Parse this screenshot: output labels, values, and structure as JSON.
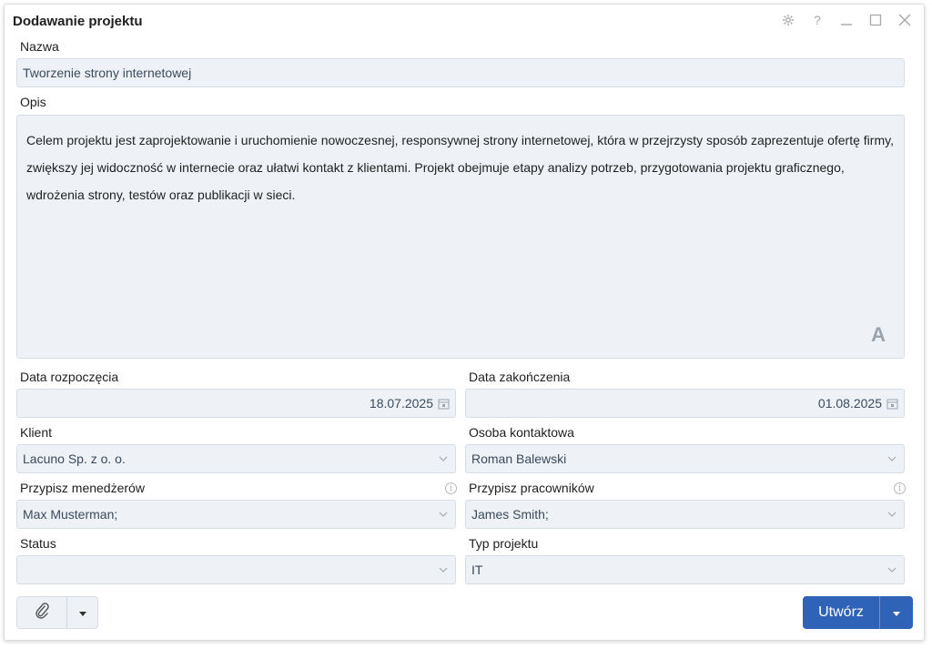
{
  "dialog": {
    "title": "Dodawanie projektu"
  },
  "icons": {
    "settings": "gear-icon",
    "help": "question-icon",
    "minimize": "minimize-icon",
    "maximize": "maximize-icon",
    "close": "close-icon",
    "text_format": "font-icon",
    "attach": "paperclip-icon",
    "info": "info-icon",
    "calendar": "calendar-icon",
    "chevron": "chevron-down-icon",
    "caret": "caret-down-icon"
  },
  "window_controls": {
    "help_glyph": "?"
  },
  "form": {
    "name": {
      "label": "Nazwa",
      "value": "Tworzenie strony internetowej"
    },
    "description": {
      "label": "Opis",
      "value": "Celem projektu jest zaprojektowanie i uruchomienie nowoczesnej, responsywnej strony internetowej, która w przejrzysty sposób zaprezentuje ofertę firmy, zwiększy jej widoczność w internecie oraz ułatwi kontakt z klientami. Projekt obejmuje etapy analizy potrzeb, przygotowania projektu graficznego, wdrożenia strony, testów oraz publikacji w sieci.",
      "format_glyph": "A"
    },
    "start_date": {
      "label": "Data rozpoczęcia",
      "value": "18.07.2025"
    },
    "end_date": {
      "label": "Data zakończenia",
      "value": "01.08.2025"
    },
    "client": {
      "label": "Klient",
      "value": "Lacuno Sp. z o. o."
    },
    "contact": {
      "label": "Osoba kontaktowa",
      "value": "Roman Balewski"
    },
    "managers": {
      "label": "Przypisz menedżerów",
      "value": "Max Musterman;",
      "info_glyph": "i"
    },
    "employees": {
      "label": "Przypisz pracowników",
      "value": "James Smith;",
      "info_glyph": "i"
    },
    "status": {
      "label": "Status",
      "value": ""
    },
    "project_type": {
      "label": "Typ projektu",
      "value": "IT"
    }
  },
  "buttons": {
    "create": "Utwórz"
  },
  "colors": {
    "primary": "#2e63b8",
    "field_bg": "#eef2f6",
    "field_border": "#d7dde4"
  }
}
